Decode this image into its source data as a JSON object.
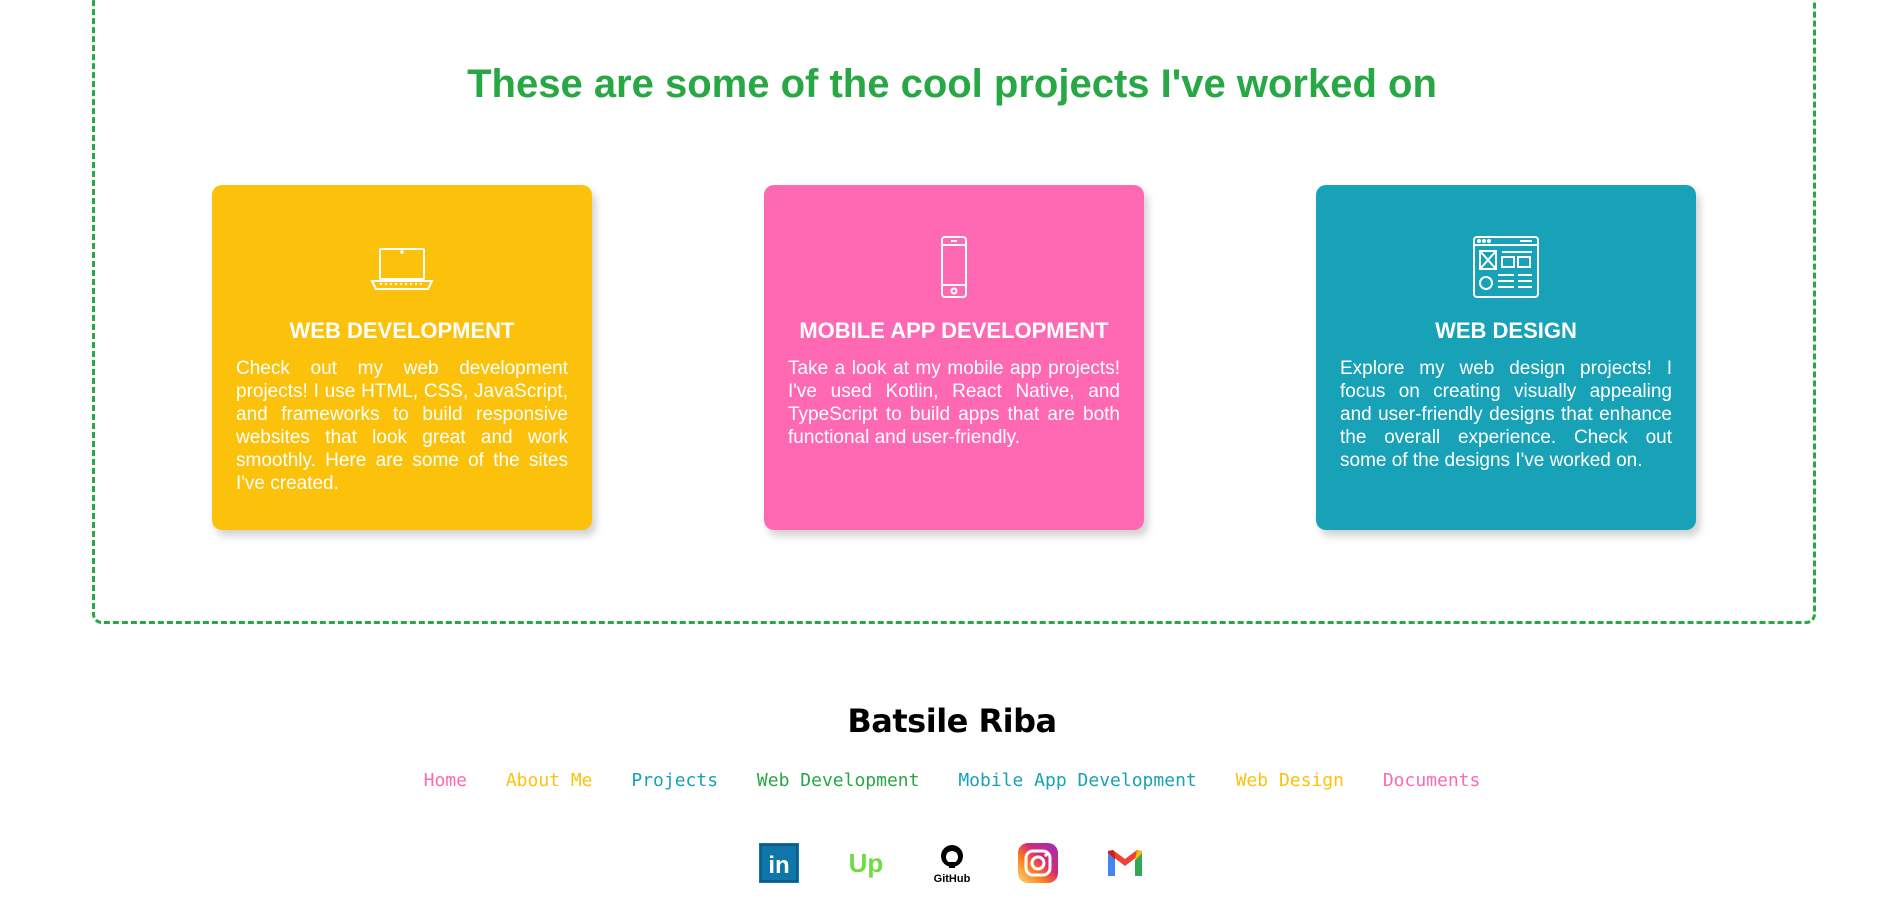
{
  "projects": {
    "heading": "These are some of the cool projects I've worked on",
    "cards": [
      {
        "title": "WEB DEVELOPMENT",
        "description": "Check out my web development projects! I use HTML, CSS, JavaScript, and frameworks to build responsive websites that look great and work smoothly. Here are some of the sites I've created.",
        "color": "#fcc10b",
        "icon": "laptop-icon"
      },
      {
        "title": "MOBILE APP DEVELOPMENT",
        "description": "Take a look at my mobile app projects! I've used Kotlin, React Native, and TypeScript to build apps that are both functional and user-friendly.",
        "color": "#ff69b4",
        "icon": "smartphone-icon"
      },
      {
        "title": "WEB DESIGN",
        "description": "Explore my web design projects! I focus on creating visually appealing and user-friendly designs that enhance the overall experience. Check out some of the designs I've worked on.",
        "color": "#17a2b8",
        "icon": "wireframe-icon"
      }
    ]
  },
  "footer": {
    "name": "Batsile Riba",
    "nav": [
      {
        "label": "Home",
        "color": "#ff69b4"
      },
      {
        "label": "About Me",
        "color": "#fcc10b"
      },
      {
        "label": "Projects",
        "color": "#17a2b8"
      },
      {
        "label": "Web Development",
        "color": "#28a745"
      },
      {
        "label": "Mobile App Development",
        "color": "#17a2b8"
      },
      {
        "label": "Web Design",
        "color": "#fcc10b"
      },
      {
        "label": "Documents",
        "color": "#ff69b4"
      }
    ],
    "socials": [
      {
        "icon": "linkedin-icon",
        "text": "in"
      },
      {
        "icon": "upwork-icon",
        "text": "Up"
      },
      {
        "icon": "github-icon",
        "text": "GitHub"
      },
      {
        "icon": "instagram-icon"
      },
      {
        "icon": "gmail-icon"
      }
    ]
  },
  "colors": {
    "accent_green": "#28a745"
  }
}
